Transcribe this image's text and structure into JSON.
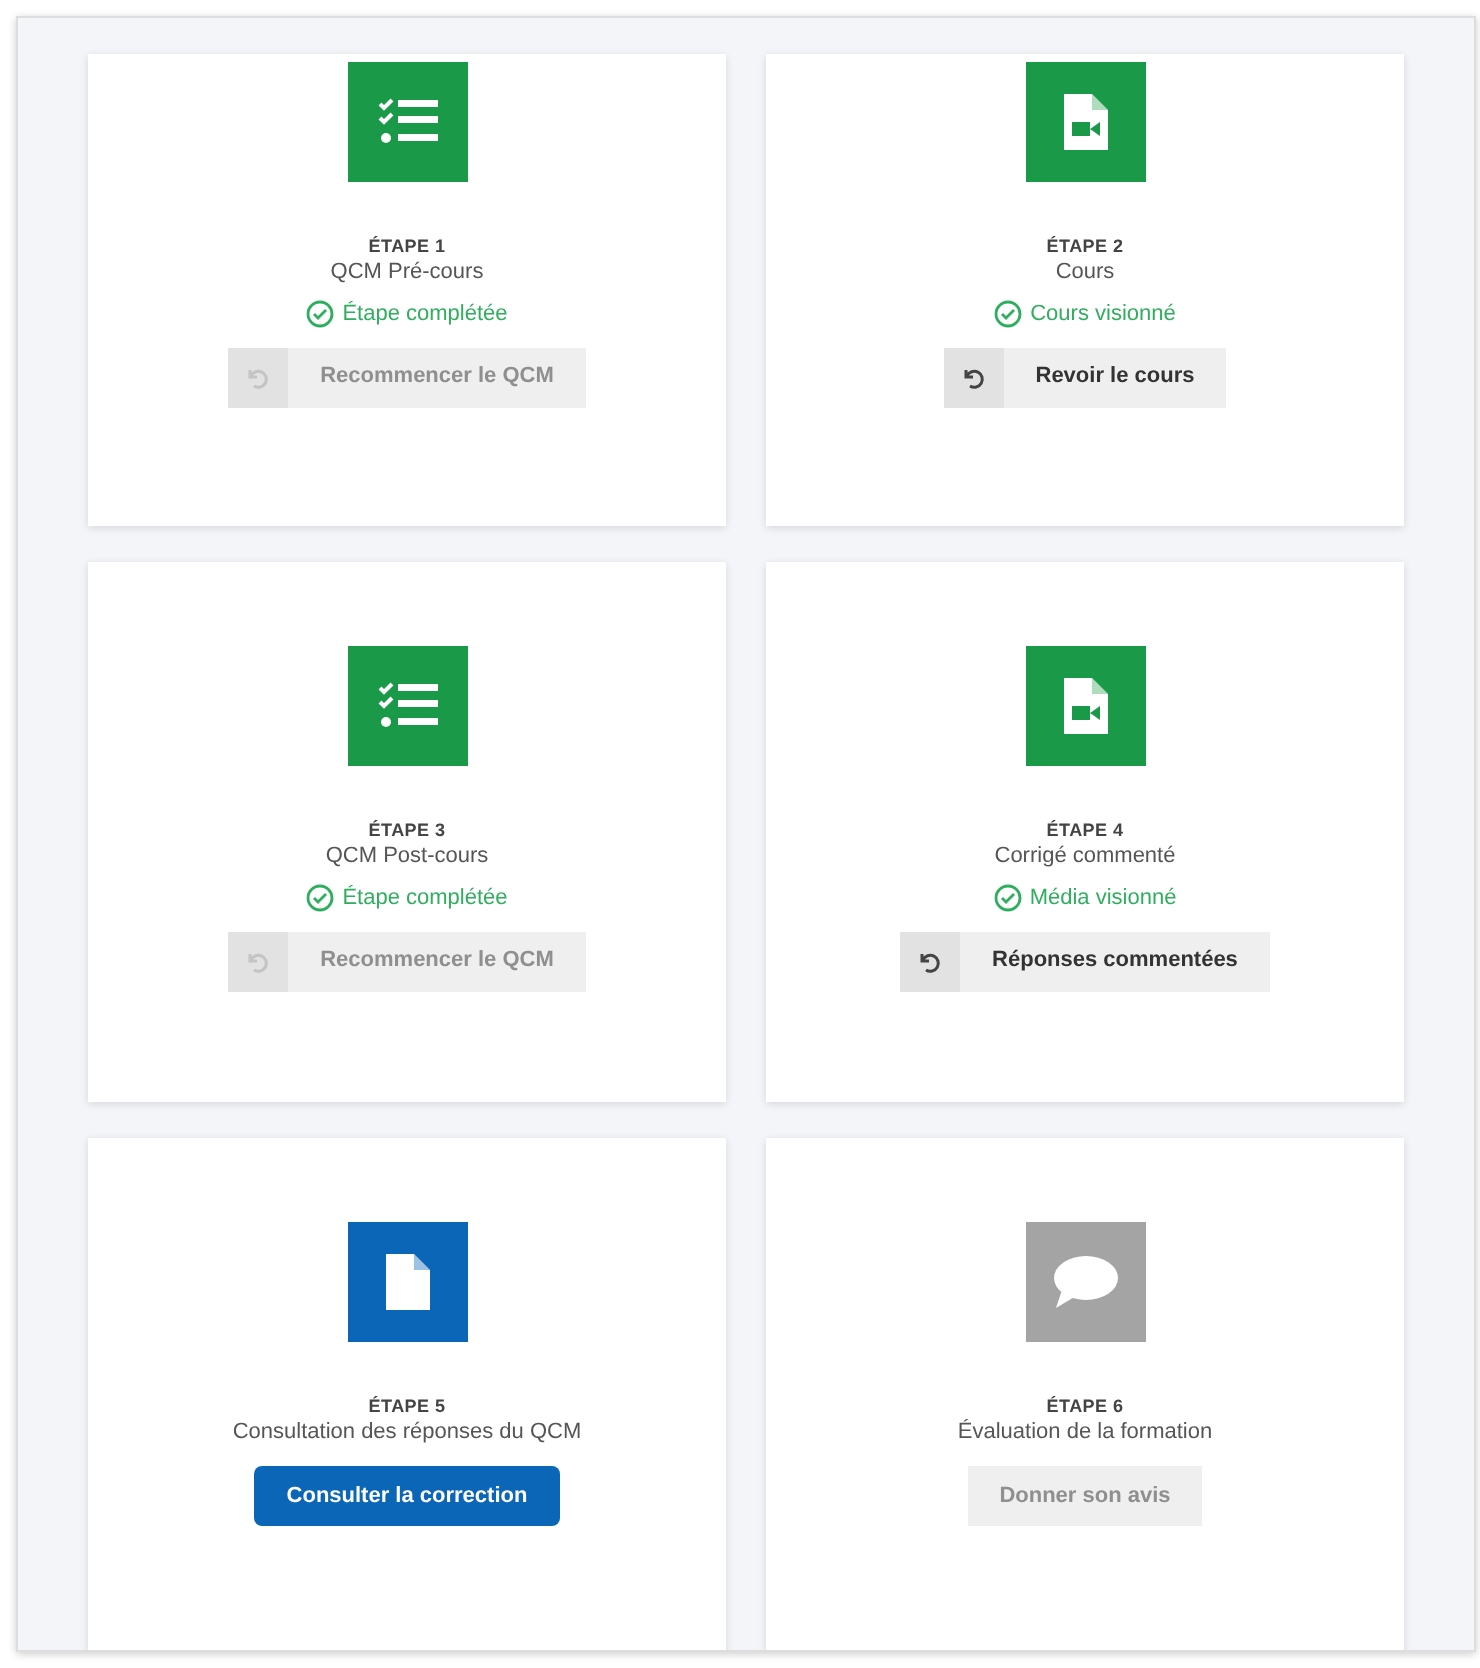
{
  "steps": [
    {
      "kind": "quiz",
      "color": "#1a9a48",
      "label": "ÉTAPE 1",
      "title": "QCM Pré-cours",
      "status": "Étape complétée",
      "button": {
        "kind": "restart",
        "label": "Recommencer le QCM",
        "disabled": true
      }
    },
    {
      "kind": "video",
      "color": "#1a9a48",
      "label": "ÉTAPE 2",
      "title": "Cours",
      "status": "Cours visionné",
      "button": {
        "kind": "restart",
        "label": "Revoir le cours",
        "disabled": false
      }
    },
    {
      "kind": "quiz",
      "color": "#1a9a48",
      "label": "ÉTAPE 3",
      "title": "QCM Post-cours",
      "status": "Étape complétée",
      "button": {
        "kind": "restart",
        "label": "Recommencer le QCM",
        "disabled": true
      }
    },
    {
      "kind": "video",
      "color": "#1a9a48",
      "label": "ÉTAPE 4",
      "title": "Corrigé commenté",
      "status": "Média visionné",
      "button": {
        "kind": "restart",
        "label": "Réponses commentées",
        "disabled": false
      }
    },
    {
      "kind": "document",
      "color": "#0b66b8",
      "label": "ÉTAPE 5",
      "title": "Consultation des réponses du QCM",
      "button": {
        "kind": "plain",
        "label": "Consulter la correction",
        "disabled": false
      }
    },
    {
      "kind": "comment",
      "color": "#a4a4a4",
      "label": "ÉTAPE 6",
      "title": "Évaluation de la formation",
      "button": {
        "kind": "plain",
        "label": "Donner son avis",
        "disabled": true
      }
    }
  ]
}
